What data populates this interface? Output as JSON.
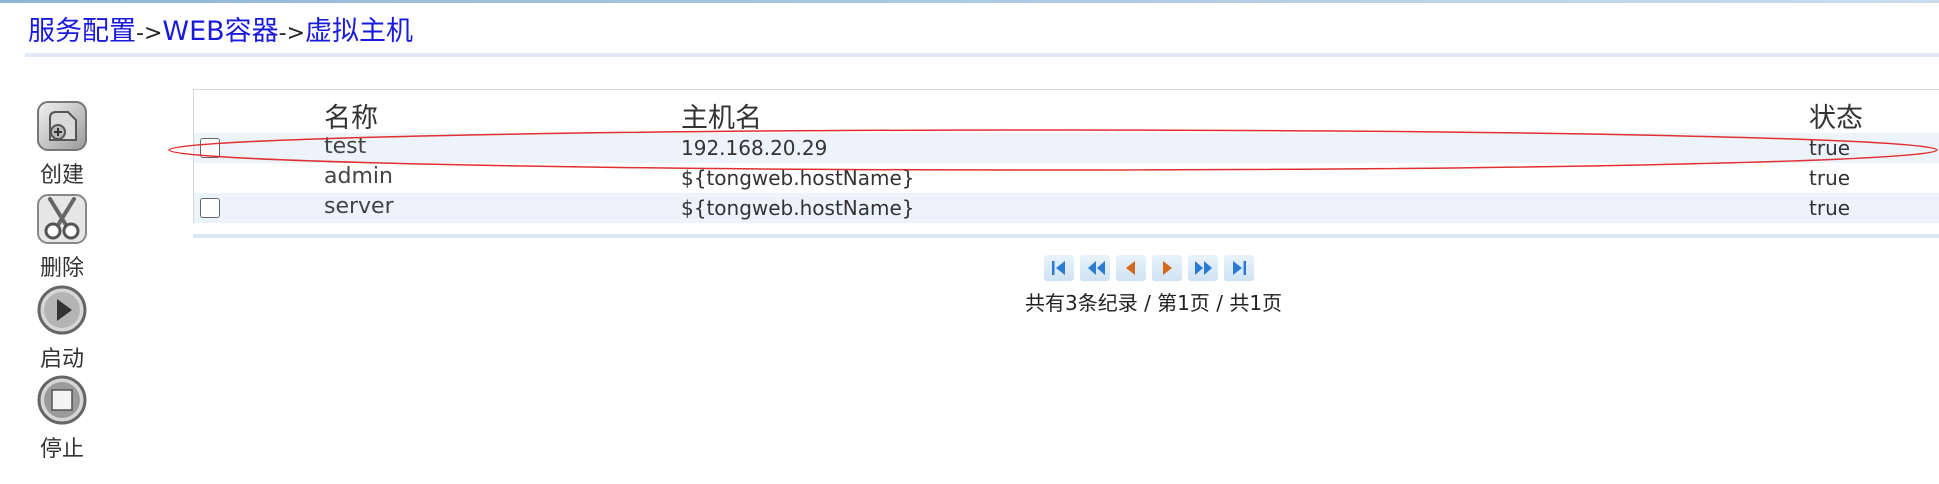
{
  "breadcrumb": {
    "items": [
      "服务配置",
      "WEB容器",
      "虚拟主机"
    ],
    "separator": "->"
  },
  "toolbar": {
    "create_label": "创建",
    "delete_label": "删除",
    "start_label": "启动",
    "stop_label": "停止"
  },
  "table": {
    "headers": {
      "name": "名称",
      "host": "主机名",
      "status": "状态"
    },
    "rows": [
      {
        "name": "test",
        "host": "192.168.20.29",
        "status": "true",
        "checkbox": true
      },
      {
        "name": "admin",
        "host": "${tongweb.hostName}",
        "status": "true",
        "checkbox": false
      },
      {
        "name": "server",
        "host": "${tongweb.hostName}",
        "status": "true",
        "checkbox": true
      }
    ]
  },
  "pager": {
    "summary": "共有3条纪录 / 第1页 / 共1页",
    "buttons": [
      "first-page",
      "fast-back",
      "previous-page",
      "next-page",
      "fast-forward",
      "last-page"
    ]
  },
  "colors": {
    "breadcrumb_link": "#1a1adc",
    "row_alt": "#ecf3fb",
    "highlight_ellipse": "#e03030",
    "pager_icon_blue": "#2b7bd4",
    "pager_icon_orange": "#d2691e"
  },
  "icons": {
    "create": "create-icon",
    "delete": "scissors-icon",
    "start": "play-icon",
    "stop": "stop-icon"
  }
}
